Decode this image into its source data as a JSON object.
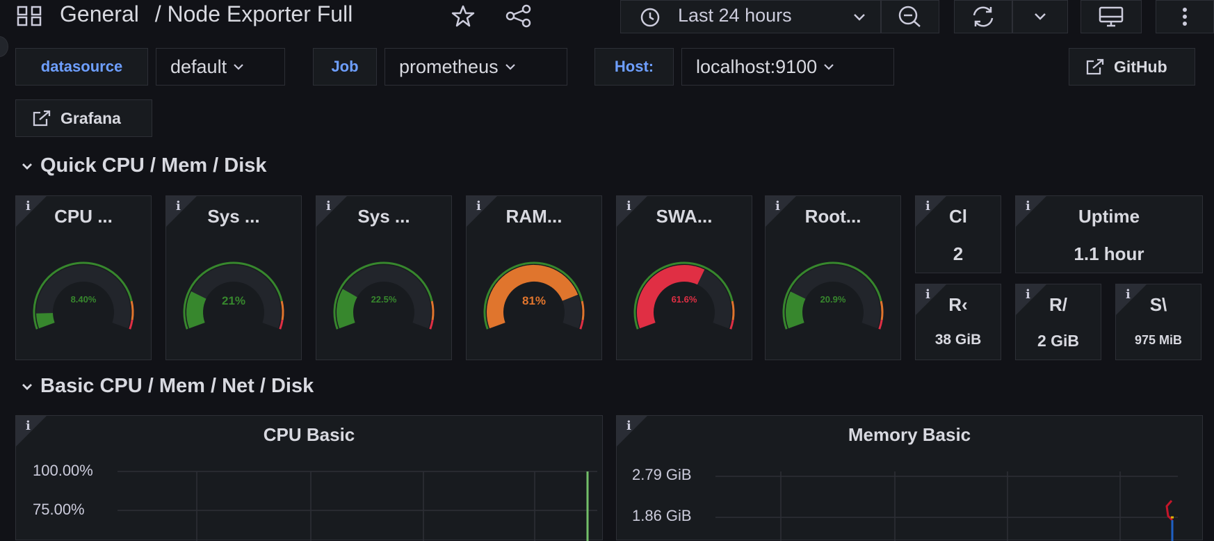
{
  "header": {
    "breadcrumb_folder": "General",
    "breadcrumb_separator": "/",
    "dashboard_title": "Node Exporter Full",
    "time_range": "Last 24 hours"
  },
  "variables": [
    {
      "label": "datasource",
      "value": "default"
    },
    {
      "label": "Job",
      "value": "prometheus"
    },
    {
      "label": "Host:",
      "value": "localhost:9100"
    }
  ],
  "links": {
    "github": "GitHub",
    "grafana": "Grafana"
  },
  "rows": {
    "quick": "Quick CPU / Mem / Disk",
    "basic": "Basic CPU / Mem / Net / Disk"
  },
  "gauges": [
    {
      "title": "CPU ...",
      "value": "8.40%",
      "fraction": 0.084,
      "color": "#37872d"
    },
    {
      "title": "Sys ...",
      "value": "21%",
      "fraction": 0.21,
      "color": "#37872d"
    },
    {
      "title": "Sys ...",
      "value": "22.5%",
      "fraction": 0.225,
      "color": "#37872d"
    },
    {
      "title": "RAM...",
      "value": "81%",
      "fraction": 0.81,
      "color": "#e0752d"
    },
    {
      "title": "SWA...",
      "value": "61.6%",
      "fraction": 0.616,
      "color": "#e02f44"
    },
    {
      "title": "Root...",
      "value": "20.9%",
      "fraction": 0.209,
      "color": "#37872d"
    }
  ],
  "stats": {
    "cores": {
      "title": "Cl",
      "value": "2"
    },
    "uptime": {
      "title": "Uptime",
      "value": "1.1 hour"
    },
    "rootfs": {
      "title": "R‹",
      "value": "38 GiB"
    },
    "ram": {
      "title": "R/",
      "value": "2 GiB"
    },
    "swap": {
      "title": "S\\",
      "value": "975 MiB"
    }
  },
  "charts": {
    "cpu": {
      "title": "CPU Basic",
      "y_ticks": [
        "100.00%",
        "75.00%"
      ]
    },
    "memory": {
      "title": "Memory Basic",
      "y_ticks": [
        "2.79 GiB",
        "1.86 GiB"
      ]
    }
  },
  "colors": {
    "ok": "#37872d",
    "warn": "#e0752d",
    "critical": "#e02f44",
    "accent": "#6e9fff"
  }
}
